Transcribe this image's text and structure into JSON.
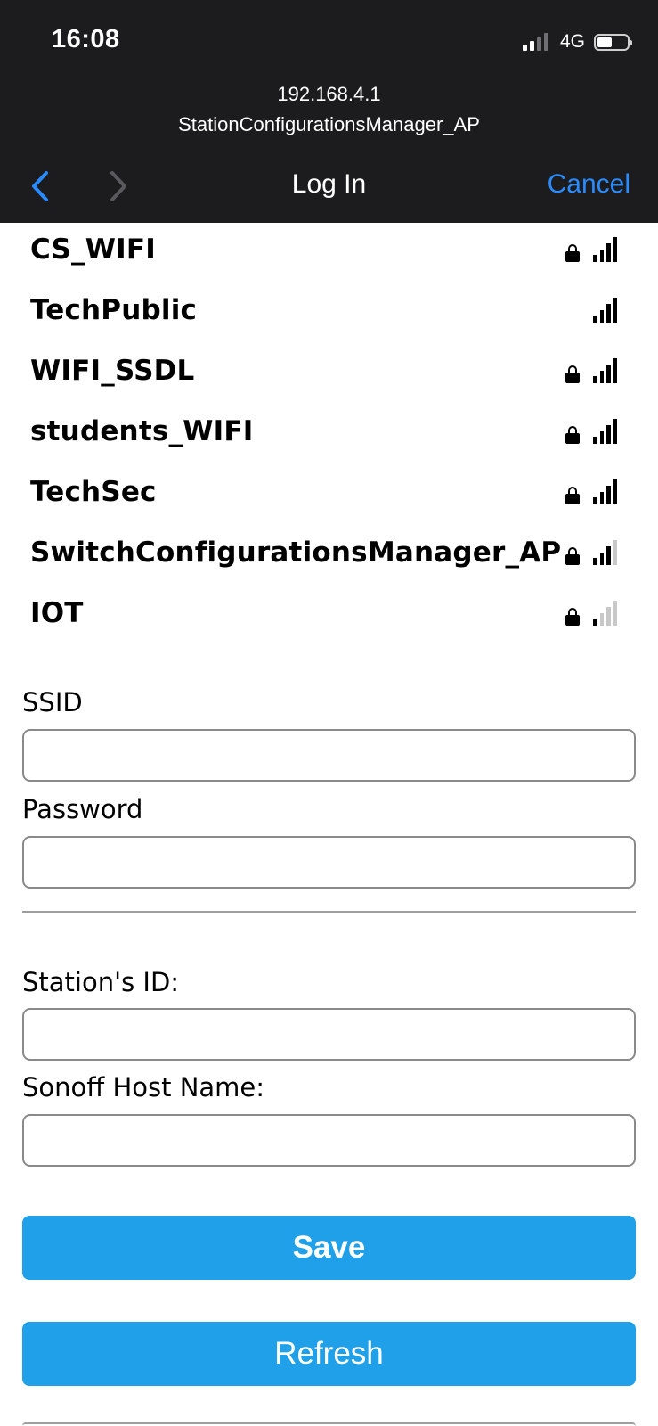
{
  "status_bar": {
    "time": "16:08",
    "network": "4G",
    "signal_bars_active": 2,
    "signal_bars_total": 4,
    "battery_level": 0.5
  },
  "browser": {
    "host": "192.168.4.1",
    "network_name": "StationConfigurationsManager_AP",
    "title": "Log In",
    "cancel_label": "Cancel",
    "back_icon": "chevron-left-icon",
    "forward_icon": "chevron-right-icon",
    "accent_color": "#2a8bff"
  },
  "networks": [
    {
      "name": "CS_WIFI",
      "locked": true,
      "signal": 4
    },
    {
      "name": "TechPublic",
      "locked": false,
      "signal": 4
    },
    {
      "name": "WIFI_SSDL",
      "locked": true,
      "signal": 4
    },
    {
      "name": "students_WIFI",
      "locked": true,
      "signal": 4
    },
    {
      "name": "TechSec",
      "locked": true,
      "signal": 4
    },
    {
      "name": "SwitchConfigurationsManager_AP",
      "locked": true,
      "signal": 3
    },
    {
      "name": "IOT",
      "locked": true,
      "signal": 1
    }
  ],
  "form": {
    "ssid_label": "SSID",
    "ssid_value": "",
    "password_label": "Password",
    "password_value": "",
    "station_id_label": "Station's ID:",
    "station_id_value": "",
    "host_name_label": "Sonoff Host Name:",
    "host_name_value": ""
  },
  "buttons": {
    "save_label": "Save",
    "refresh_label": "Refresh",
    "button_color": "#1fa0e8"
  }
}
